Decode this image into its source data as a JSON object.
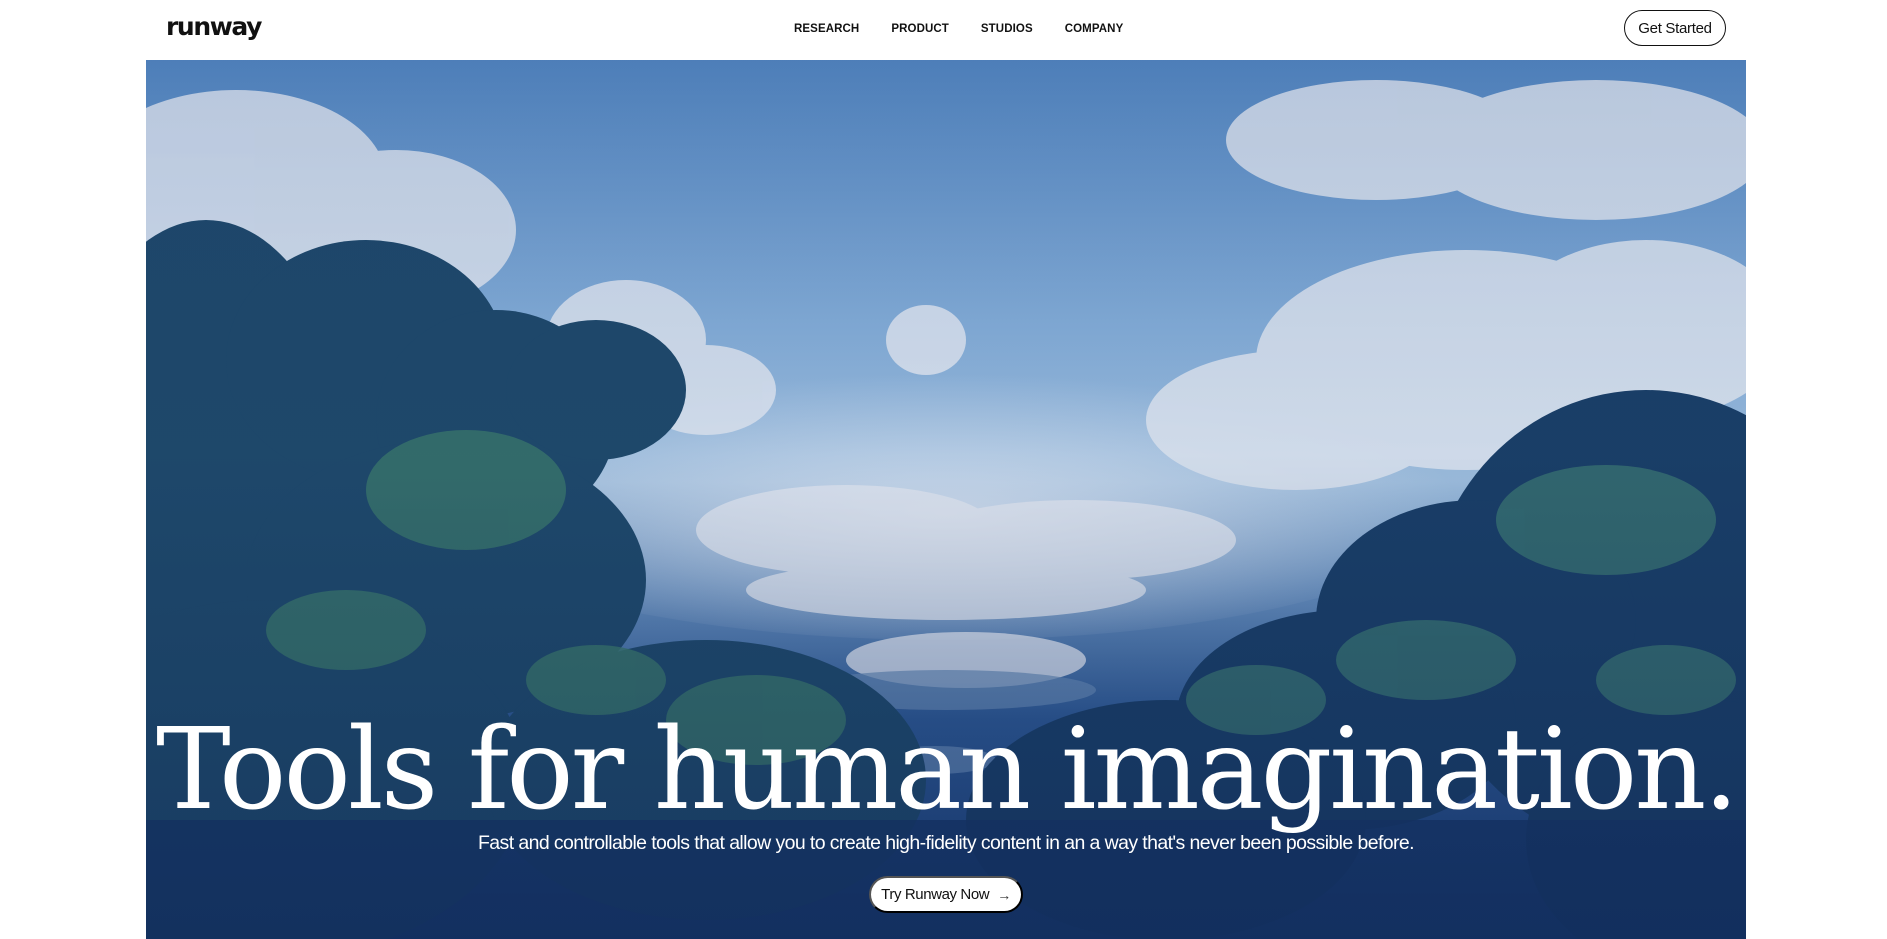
{
  "header": {
    "logo": "runway",
    "nav": [
      {
        "label": "RESEARCH"
      },
      {
        "label": "PRODUCT"
      },
      {
        "label": "STUDIOS"
      },
      {
        "label": "COMPANY"
      }
    ],
    "cta_label": "Get Started"
  },
  "hero": {
    "headline": "Tools for human imagination.",
    "subhead": "Fast and controllable tools that allow you to create high-fidelity content in an a way that's never been possible before.",
    "cta_label": "Try Runway Now",
    "cta_icon": "arrow-right-icon"
  },
  "colors": {
    "background": "#ffffff",
    "text": "#111111",
    "hero_sky": "#8db7e0",
    "hero_deep": "#1d3f75"
  }
}
